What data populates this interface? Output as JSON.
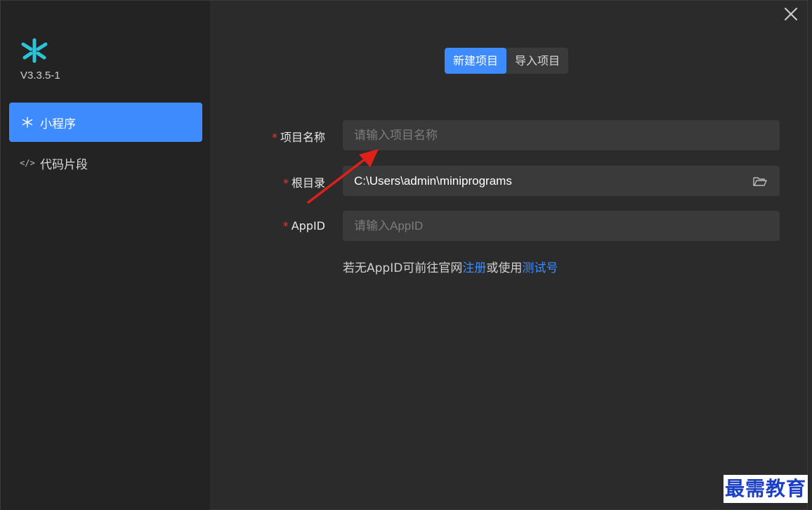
{
  "app": {
    "version": "V3.3.5-1"
  },
  "sidebar": {
    "items": [
      {
        "label": "小程序",
        "icon": "miniprogram-icon",
        "active": true
      },
      {
        "label": "代码片段",
        "icon": "code-icon",
        "active": false
      }
    ]
  },
  "tabs": [
    {
      "label": "新建项目",
      "active": true
    },
    {
      "label": "导入项目",
      "active": false
    }
  ],
  "form": {
    "required_mark": "*",
    "project_name": {
      "label": "项目名称",
      "value": "",
      "placeholder": "请输入项目名称"
    },
    "root_dir": {
      "label": "根目录",
      "value": "C:\\Users\\admin\\miniprograms",
      "placeholder": ""
    },
    "appid": {
      "label": "AppID",
      "value": "",
      "placeholder": "请输入AppID"
    }
  },
  "hint": {
    "prefix": "若无AppID可前往官网",
    "register_link": "注册",
    "middle": "或使用",
    "test_link": "测试号"
  },
  "watermark": "最需教育",
  "colors": {
    "accent": "#3d8bfd",
    "required": "#e53935",
    "logo": "#2bc4d8",
    "arrow": "#e0201b"
  }
}
